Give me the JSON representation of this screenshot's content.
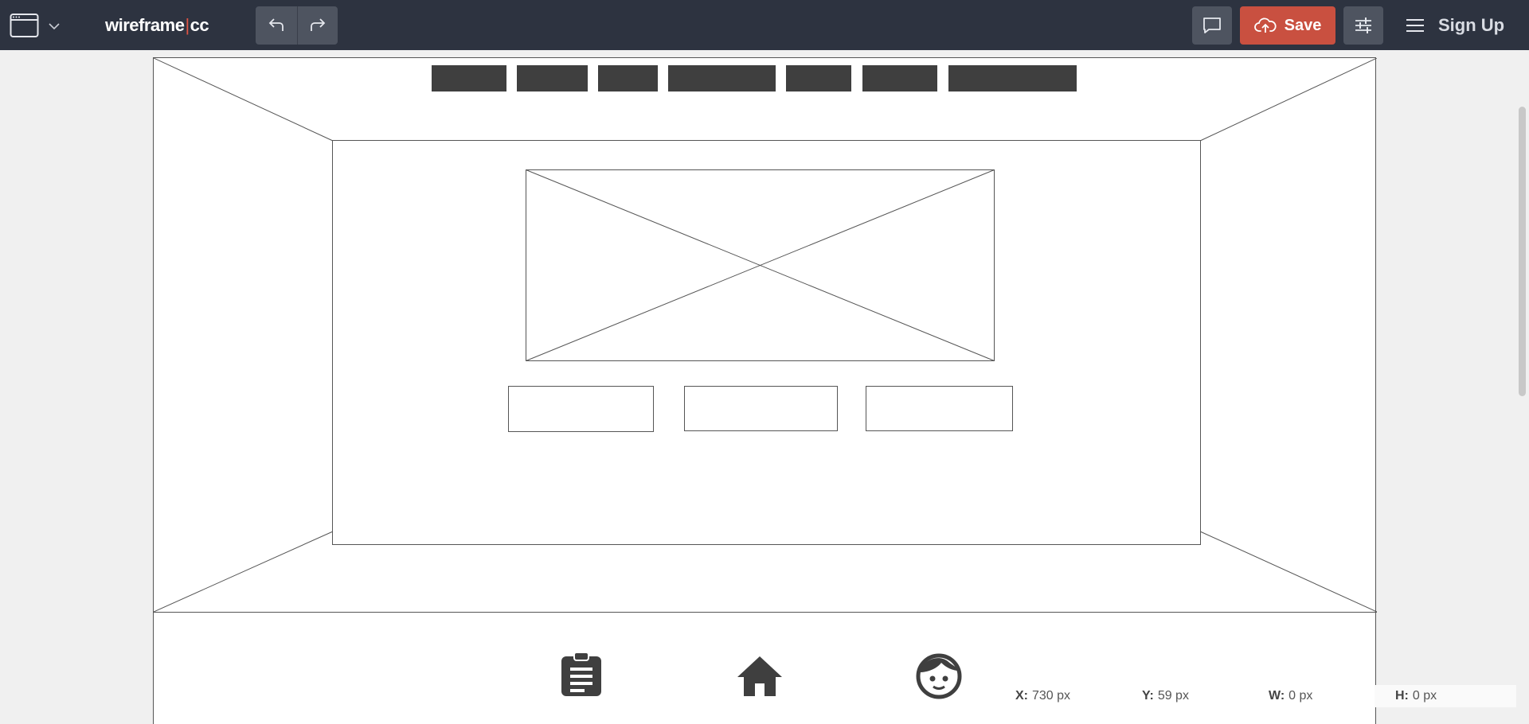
{
  "app": {
    "logo_left": "wireframe",
    "logo_pipe": "|",
    "logo_right": "cc"
  },
  "toolbar": {
    "page_type_icon": "browser-window-icon",
    "dropdown_icon": "chevron-down-icon",
    "undo_icon": "undo-icon",
    "redo_icon": "redo-icon",
    "comment_icon": "comment-icon",
    "save_label": "Save",
    "save_icon": "cloud-upload-icon",
    "settings_icon": "sliders-icon",
    "menu_icon": "hamburger-menu-icon",
    "signup_label": "Sign Up",
    "save_color": "#c95040",
    "bar_color": "#2d3340"
  },
  "canvas": {
    "nav_items_count": 7,
    "action_buttons_count": 3,
    "footer_icons": [
      "clipboard-icon",
      "home-icon",
      "face-icon"
    ],
    "block_color": "#3f3f3f"
  },
  "coords": {
    "x_label": "X:",
    "x_value": "730 px",
    "y_label": "Y:",
    "y_value": "59 px",
    "w_label": "W:",
    "w_value": "0 px",
    "h_label": "H:",
    "h_value": "0 px"
  }
}
